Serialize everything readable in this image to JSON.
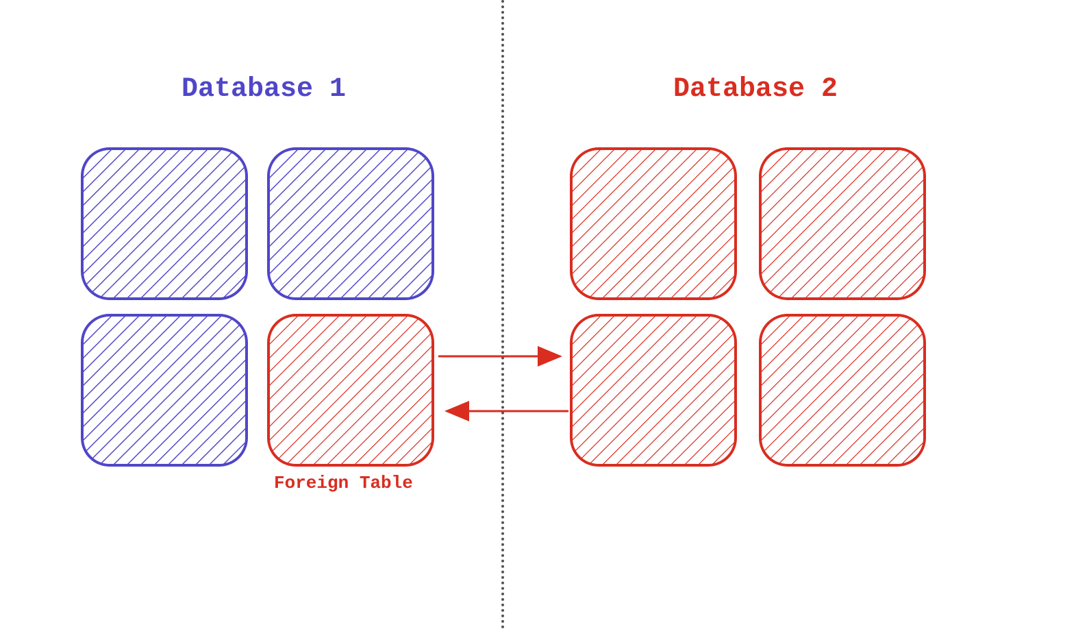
{
  "titles": {
    "left": "Database 1",
    "right": "Database 2"
  },
  "caption": {
    "foreign_table": "Foreign Table"
  },
  "colors": {
    "purple": "#5046C8",
    "red": "#D92D20",
    "divider": "#555555"
  },
  "layout": {
    "boxes": {
      "db1": [
        {
          "row": 0,
          "col": 0,
          "color": "purple"
        },
        {
          "row": 0,
          "col": 1,
          "color": "purple"
        },
        {
          "row": 1,
          "col": 0,
          "color": "purple"
        },
        {
          "row": 1,
          "col": 1,
          "color": "red",
          "label_key": "caption.foreign_table"
        }
      ],
      "db2": [
        {
          "row": 0,
          "col": 0,
          "color": "red"
        },
        {
          "row": 0,
          "col": 1,
          "color": "red"
        },
        {
          "row": 1,
          "col": 0,
          "color": "red"
        },
        {
          "row": 1,
          "col": 1,
          "color": "red"
        }
      ]
    },
    "arrows": [
      {
        "direction": "right",
        "from": "db1.foreign_table",
        "to": "db2.row1col0"
      },
      {
        "direction": "left",
        "from": "db2.row1col0",
        "to": "db1.foreign_table"
      }
    ]
  }
}
